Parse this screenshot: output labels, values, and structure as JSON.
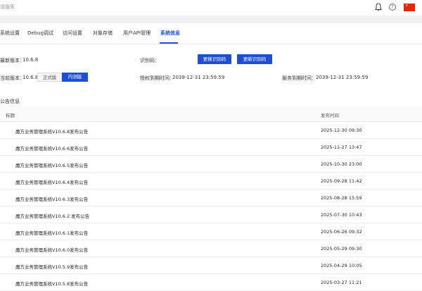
{
  "header": {
    "search_placeholder": "请搜索",
    "help_glyph": "?"
  },
  "tabs": [
    {
      "label": "系统设置"
    },
    {
      "label": "Debug调试"
    },
    {
      "label": "访问设置"
    },
    {
      "label": "对象存储"
    },
    {
      "label": "用户API管理"
    },
    {
      "label": "系统信息",
      "active": true
    }
  ],
  "system_info": {
    "latest_version_label": "最新版本：",
    "latest_version": "10.6.8",
    "current_version_label": "当前版本：",
    "current_version": "10.6.8",
    "channel_stable": "正式版",
    "channel_beta": "内测版",
    "channel_selected": "内测版",
    "id_code_label": "识别码：",
    "btn_replace_code": "更换识别码",
    "btn_update_code": "更新识别码",
    "license_expiry_label": "授权到期时间：",
    "license_expiry": "2039-12-31 23:59:59",
    "service_expiry_label": "服务到期时间：",
    "service_expiry": "2039-12-31 23:59:59"
  },
  "announcements": {
    "section_title": "公告信息",
    "columns": {
      "title": "标题",
      "time": "发布时间"
    },
    "rows": [
      {
        "title": "魔方业务管理系统V10.6.8发布公告",
        "time": "2025-12-30 09:30"
      },
      {
        "title": "魔方业务管理系统V10.6.6发布公告",
        "time": "2025-11-27 13:47"
      },
      {
        "title": "魔方业务管理系统V10.6.5发布公告",
        "time": "2025-10-30 23:00"
      },
      {
        "title": "魔方业务管理系统V10.6.4发布公告",
        "time": "2025-09-28 11:42"
      },
      {
        "title": "魔方业务管理系统V10.6.3发布公告",
        "time": "2025-08-28 15:59"
      },
      {
        "title": "魔方业务管理系统V10.6.2 发布公告",
        "time": "2025-07-30 10:43"
      },
      {
        "title": "魔方业务管理系统V10.6.1发布公告",
        "time": "2025-06-26 09:32"
      },
      {
        "title": "魔方业务管理系统V10.6.0发布公告",
        "time": "2025-05-29 09:30"
      },
      {
        "title": "魔方业务管理系统V10.5.9发布公告",
        "time": "2025-04-29 10:05"
      },
      {
        "title": "魔方业务管理系统V10.5.8发布公告",
        "time": "2025-03-27 11:21"
      }
    ]
  },
  "colors": {
    "primary": "#1d4ed8",
    "flag_red": "#de2910",
    "flag_star": "#ffde00"
  }
}
